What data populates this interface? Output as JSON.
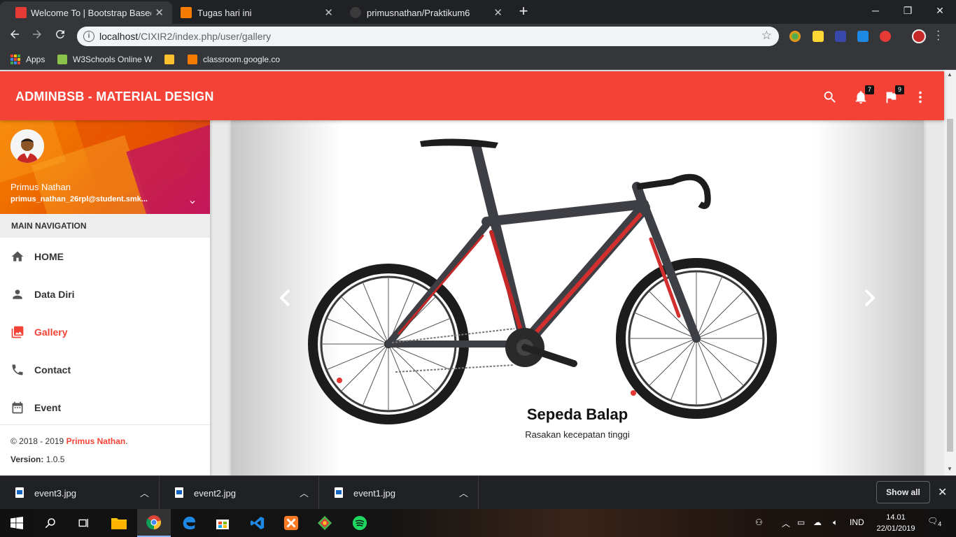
{
  "browser": {
    "tabs": [
      {
        "title": "Welcome To | Bootstrap Based Ad",
        "favicon_color": "#e53935",
        "active": true
      },
      {
        "title": "Tugas hari ini",
        "favicon_color": "#f57c00",
        "active": false
      },
      {
        "title": "primusnathan/Praktikum6",
        "favicon_color": "#24292e",
        "active": false
      }
    ],
    "url_host": "localhost",
    "url_path": "/CIXIR2/index.php/user/gallery",
    "bookmarks": [
      {
        "label": "Apps",
        "icon": "apps-grid-icon"
      },
      {
        "label": "W3Schools Online W",
        "icon": "w3schools-icon",
        "color": "#8bc34a"
      },
      {
        "label": "",
        "icon": "google-classroom-icon",
        "color": "#fbc02d"
      },
      {
        "label": "classroom.google.co",
        "icon": "classroom-icon",
        "color": "#f57c00"
      }
    ]
  },
  "app": {
    "brand": "ADMINBSB - MATERIAL DESIGN",
    "notifications_count": "7",
    "tasks_count": "9",
    "accent": "#f44336"
  },
  "user": {
    "name": "Primus Nathan",
    "email": "primus_nathan_26rpl@student.smk..."
  },
  "nav": {
    "header": "MAIN NAVIGATION",
    "items": [
      {
        "label": "HOME",
        "icon": "home-icon"
      },
      {
        "label": "Data Diri",
        "icon": "person-icon"
      },
      {
        "label": "Gallery",
        "icon": "image-icon",
        "active": true
      },
      {
        "label": "Contact",
        "icon": "phone-icon"
      },
      {
        "label": "Event",
        "icon": "calendar-icon"
      }
    ]
  },
  "footer": {
    "copyright": "© 2018 - 2019",
    "author": "Primus Nathan",
    "version_label": "Version:",
    "version": "1.0.5"
  },
  "carousel": {
    "caption_title": "Sepeda Balap",
    "caption_text": "Rasakan kecepatan tinggi",
    "image": "road-bike-photo"
  },
  "downloads": {
    "files": [
      "event3.jpg",
      "event2.jpg",
      "event1.jpg"
    ],
    "show_all": "Show all"
  },
  "taskbar": {
    "language": "IND",
    "time": "14.01",
    "date": "22/01/2019",
    "notifications": "4"
  }
}
